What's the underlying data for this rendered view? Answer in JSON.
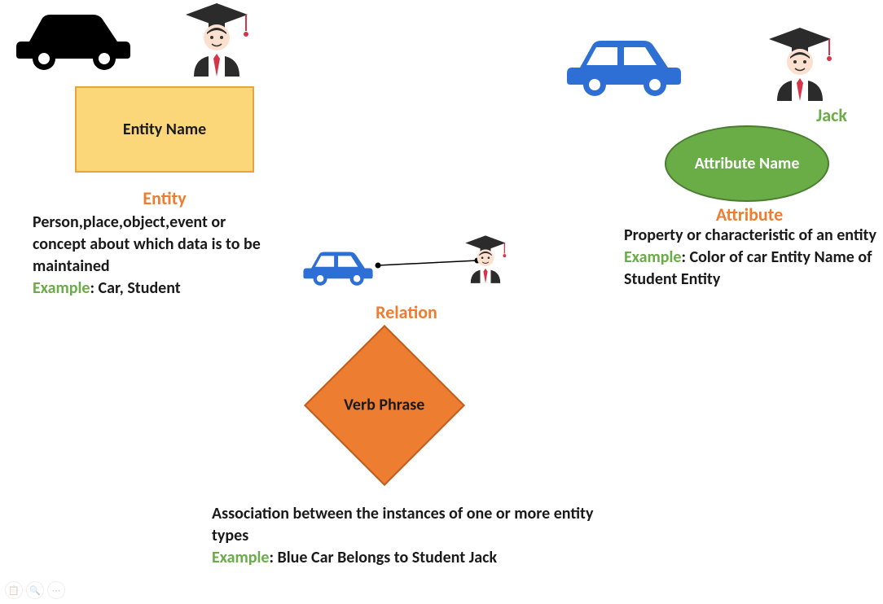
{
  "entity": {
    "shape_label": "Entity Name",
    "title": "Entity",
    "description": "Person,place,object,event or concept about which data is to be maintained",
    "example_label": "Example",
    "example_text": ": Car, Student"
  },
  "attribute": {
    "shape_label": "Attribute Name",
    "title": "Attribute",
    "student_name": "Jack",
    "description": "Property or characteristic of an entity",
    "example_label": "Example",
    "example_text": ": Color of car Entity Name of Student Entity"
  },
  "relation": {
    "shape_label": "Verb Phrase",
    "title": "Relation",
    "description": "Association between the instances of one or more entity types",
    "example_label": "Example",
    "example_text": ": Blue Car Belongs to Student Jack"
  }
}
